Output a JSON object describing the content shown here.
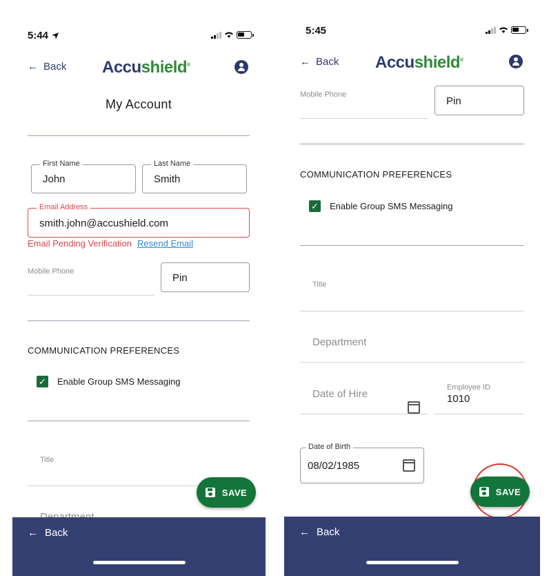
{
  "left_screen": {
    "status": {
      "time": "5:44"
    },
    "header": {
      "back_label": "Back",
      "logo_part1": "Accu",
      "logo_part2": "shield",
      "logo_mark": "®"
    },
    "page_title": "My Account",
    "first_name": {
      "label": "First Name",
      "value": "John"
    },
    "last_name": {
      "label": "Last Name",
      "value": "Smith"
    },
    "email": {
      "label": "Email Address",
      "value": "smith.john@accushield.com",
      "error": "Email Pending Verification",
      "resend": "Resend Email"
    },
    "mobile_phone": {
      "label": "Mobile Phone"
    },
    "pin": {
      "placeholder": "Pin"
    },
    "comm_prefs": {
      "title": "COMMUNICATION PREFERENCES",
      "sms_label": "Enable Group SMS Messaging",
      "sms_checked": true
    },
    "title_field": {
      "label": "Title"
    },
    "department_field": {
      "label": "Department"
    },
    "save_button": {
      "label": "SAVE"
    },
    "bottom_bar": {
      "back_label": "Back"
    }
  },
  "right_screen": {
    "status": {
      "time": "5:45"
    },
    "header": {
      "back_label": "Back",
      "logo_part1": "Accu",
      "logo_part2": "shield",
      "logo_mark": "®"
    },
    "mobile_phone": {
      "label": "Mobile Phone"
    },
    "pin": {
      "placeholder": "Pin"
    },
    "comm_prefs": {
      "title": "COMMUNICATION PREFERENCES",
      "sms_label": "Enable Group SMS Messaging",
      "sms_checked": true
    },
    "title_field": {
      "label": "Title"
    },
    "department_field": {
      "placeholder": "Department"
    },
    "date_of_hire": {
      "placeholder": "Date of Hire"
    },
    "employee_id": {
      "label": "Employee ID",
      "value": "1010"
    },
    "date_of_birth": {
      "label": "Date of Birth",
      "value": "08/02/1985"
    },
    "save_button": {
      "label": "SAVE"
    },
    "bottom_bar": {
      "back_label": "Back"
    }
  },
  "colors": {
    "primary_navy": "#2d3a6b",
    "bottom_bar": "#354072",
    "save_green": "#137539",
    "checkbox_green": "#1a6b3a",
    "error_red": "#e0454b",
    "link_blue": "#2a8adf",
    "highlight_red": "#e2322f"
  },
  "icons": [
    "location-arrow-icon",
    "signal-icon",
    "wifi-icon",
    "battery-icon",
    "back-arrow-icon",
    "account-circle-icon",
    "checkbox-checked-icon",
    "save-icon",
    "calendar-icon"
  ]
}
